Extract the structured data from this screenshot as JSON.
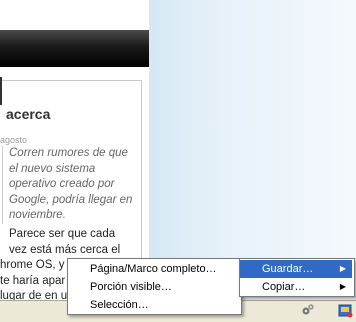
{
  "blog": {
    "title": "acerca",
    "date": "agosto",
    "quote": "Corren rumores de que el nuevo sistema operativo creado por Google, podría llegar en noviembre.",
    "body_lines": [
      "Parece ser que cada",
      "vez está más cerca el"
    ],
    "body_partial": [
      "hrome OS, y",
      "te haría apar",
      "lugar de en u"
    ]
  },
  "submenu": {
    "items": [
      "Página/Marco completo…",
      "Porción visible…",
      "Selección…"
    ]
  },
  "context_menu": {
    "items": [
      {
        "label": "Guardar…",
        "arrow": "▶"
      },
      {
        "label": "Copiar…",
        "arrow": "▶"
      }
    ]
  },
  "status_bar": {
    "icons": [
      "gears-icon",
      "extension-icon"
    ]
  }
}
